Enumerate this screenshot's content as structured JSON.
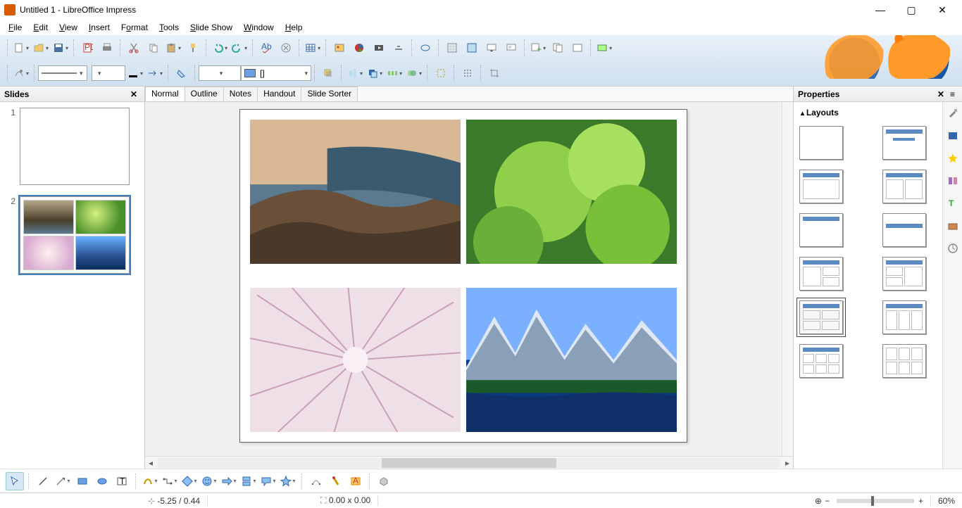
{
  "window": {
    "title": "Untitled 1 - LibreOffice Impress"
  },
  "menu": [
    "File",
    "Edit",
    "View",
    "Insert",
    "Format",
    "Tools",
    "Slide Show",
    "Window",
    "Help"
  ],
  "panels": {
    "slides": {
      "title": "Slides",
      "items": [
        {
          "num": "1"
        },
        {
          "num": "2"
        }
      ],
      "selected": 2
    },
    "properties": {
      "title": "Properties",
      "section": "Layouts"
    }
  },
  "viewTabs": {
    "items": [
      "Normal",
      "Outline",
      "Notes",
      "Handout",
      "Slide Sorter"
    ],
    "active": "Normal"
  },
  "styleCombo": "[]",
  "status": {
    "coords": "-5.25 / 0.44",
    "size": "0.00 x 0.00",
    "zoom": "60%"
  },
  "layouts": [
    "blank",
    "title",
    "title-content",
    "title-2col",
    "title-only",
    "centered-title",
    "title-2content",
    "title-content-2",
    "title-4grid",
    "title-4grid-b",
    "title-6grid",
    "6grid"
  ],
  "selectedLayout": 8,
  "colors": {
    "fill": "#e8d070",
    "shape": "#6aa0e8"
  }
}
